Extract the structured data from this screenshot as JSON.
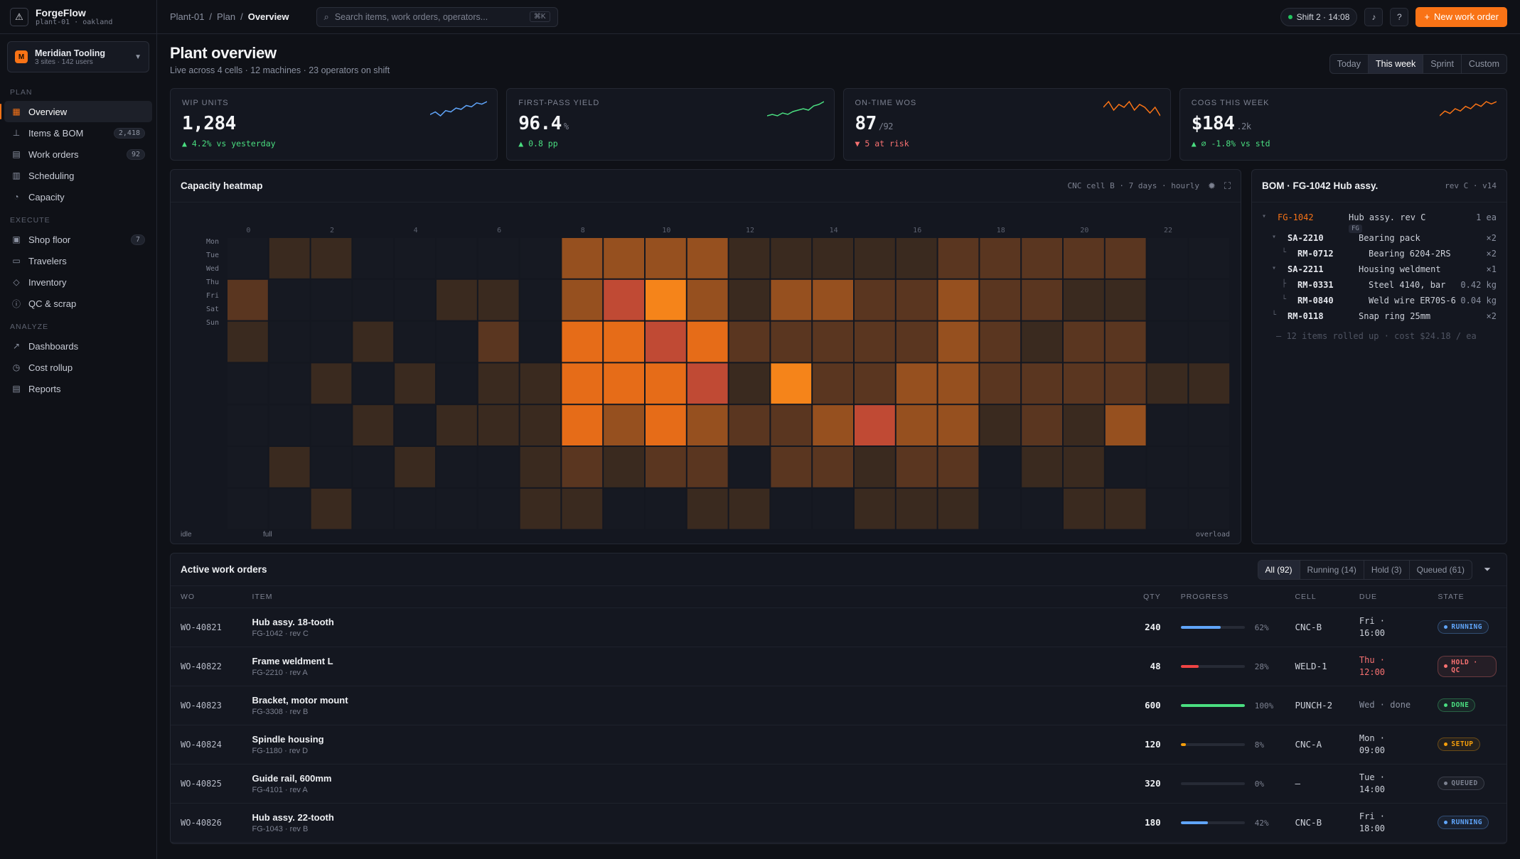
{
  "brand": {
    "name": "ForgeFlow",
    "sub": "plant-01 · oakland"
  },
  "org": {
    "initial": "M",
    "name": "Meridian Tooling",
    "sub": "3 sites · 142 users"
  },
  "nav": {
    "plan_label": "PLAN",
    "plan": [
      {
        "label": "Overview",
        "icon": "grid-icon",
        "badge": "",
        "active": true
      },
      {
        "label": "Items & BOM",
        "icon": "tree-icon",
        "badge": "2,418"
      },
      {
        "label": "Work orders",
        "icon": "doc-icon",
        "badge": "92"
      },
      {
        "label": "Scheduling",
        "icon": "bars-icon",
        "badge": ""
      },
      {
        "label": "Capacity",
        "icon": "gauge-icon",
        "badge": ""
      }
    ],
    "execute_label": "EXECUTE",
    "execute": [
      {
        "label": "Shop floor",
        "icon": "floor-icon",
        "badge": "7"
      },
      {
        "label": "Travelers",
        "icon": "folder-icon",
        "badge": ""
      },
      {
        "label": "Inventory",
        "icon": "box-icon",
        "badge": ""
      },
      {
        "label": "QC & scrap",
        "icon": "alert-icon",
        "badge": ""
      }
    ],
    "analyze_label": "ANALYZE",
    "analyze": [
      {
        "label": "Dashboards",
        "icon": "trend-icon",
        "badge": ""
      },
      {
        "label": "Cost rollup",
        "icon": "clock-icon",
        "badge": ""
      },
      {
        "label": "Reports",
        "icon": "report-icon",
        "badge": ""
      }
    ]
  },
  "breadcrumb": [
    "Plant-01",
    "Plan",
    "Overview"
  ],
  "search": {
    "placeholder": "Search items, work orders, operators...",
    "shortcut": "⌘K"
  },
  "shift": "Shift 2 · 14:08",
  "new_wo": "New work order",
  "page": {
    "title": "Plant overview",
    "sub": "Live across 4 cells · 12 machines · 23 operators on shift"
  },
  "ranges": [
    "Today",
    "This week",
    "Sprint",
    "Custom"
  ],
  "kpis": [
    {
      "label": "WIP UNITS",
      "value": "1,284",
      "unit": "",
      "delta": "▲ 4.2% vs yesterday",
      "delta_color": "#4ade80",
      "spark_color": "#60a5fa",
      "spark": [
        8,
        10,
        7,
        11,
        10,
        13,
        12,
        15,
        14,
        17,
        16,
        18
      ]
    },
    {
      "label": "FIRST-PASS YIELD",
      "value": "96.4",
      "unit": "%",
      "delta": "▲ 0.8 pp",
      "delta_color": "#4ade80",
      "spark_color": "#4ade80",
      "spark": [
        7,
        8,
        7,
        9,
        8,
        10,
        11,
        12,
        11,
        14,
        15,
        17
      ]
    },
    {
      "label": "ON-TIME WOS",
      "value": "87",
      "unit": "/92",
      "delta": "▼ 5 at risk",
      "delta_color": "#f87171",
      "spark_color": "#f97316",
      "spark": [
        14,
        16,
        13,
        15,
        14,
        16,
        13,
        15,
        14,
        12,
        14,
        11
      ]
    },
    {
      "label": "COGS THIS WEEK",
      "value": "$184",
      "unit": ".2k",
      "delta": "▲ ∅ -1.8% vs std",
      "delta_color": "#4ade80",
      "spark_color": "#f97316",
      "spark": [
        9,
        11,
        10,
        12,
        11,
        13,
        12,
        14,
        13,
        15,
        14,
        15
      ]
    }
  ],
  "heatmap": {
    "title": "Capacity heatmap",
    "meta": "CNC cell B · 7 days · hourly",
    "days": [
      "Mon",
      "Tue",
      "Wed",
      "Thu",
      "Fri",
      "Sat",
      "Sun"
    ],
    "hour_labels": [
      "0",
      "2",
      "4",
      "6",
      "8",
      "10",
      "12",
      "14",
      "16",
      "18",
      "20",
      "22"
    ],
    "legend": {
      "idle": "idle",
      "full": "full",
      "overload": "overload"
    },
    "colors": [
      "#161922",
      "#1c1f27",
      "#3a2a1f",
      "#5a3620",
      "#96501f",
      "#e66c18",
      "#f5841a",
      "#c04a34"
    ],
    "grid": [
      [
        0,
        2,
        2,
        0,
        0,
        0,
        0,
        0,
        4,
        4,
        4,
        4,
        2,
        2,
        2,
        2,
        2,
        3,
        3,
        3,
        3,
        3,
        0,
        0
      ],
      [
        3,
        0,
        0,
        0,
        0,
        2,
        2,
        0,
        4,
        7,
        6,
        4,
        2,
        4,
        4,
        3,
        3,
        4,
        3,
        3,
        2,
        2,
        0,
        0
      ],
      [
        2,
        0,
        0,
        2,
        0,
        0,
        3,
        0,
        5,
        5,
        7,
        5,
        3,
        3,
        3,
        3,
        3,
        4,
        3,
        2,
        3,
        3,
        0,
        0
      ],
      [
        0,
        0,
        2,
        0,
        2,
        0,
        2,
        2,
        5,
        5,
        5,
        7,
        2,
        6,
        3,
        3,
        4,
        4,
        3,
        3,
        3,
        3,
        2,
        2
      ],
      [
        0,
        0,
        0,
        2,
        0,
        2,
        2,
        2,
        5,
        4,
        5,
        4,
        3,
        3,
        4,
        7,
        4,
        4,
        2,
        3,
        2,
        4,
        0,
        0
      ],
      [
        0,
        2,
        0,
        0,
        2,
        0,
        0,
        2,
        3,
        2,
        3,
        3,
        0,
        3,
        3,
        2,
        3,
        3,
        0,
        2,
        2,
        0,
        0,
        0
      ],
      [
        0,
        0,
        2,
        0,
        0,
        0,
        0,
        2,
        2,
        0,
        0,
        2,
        2,
        0,
        0,
        2,
        2,
        2,
        0,
        0,
        2,
        2,
        0,
        0
      ]
    ]
  },
  "bom": {
    "title": "BOM · FG-1042 Hub assy.",
    "meta": "rev C · v14",
    "rows": [
      {
        "indent": 0,
        "caret": "▾",
        "code": "FG-1042",
        "name": "Hub assy. rev C",
        "tag": "FG",
        "qty": "1 ea",
        "accent": true
      },
      {
        "indent": 1,
        "caret": "▾",
        "code": "SA-2210",
        "name": "Bearing pack",
        "tag": "",
        "qty": "×2"
      },
      {
        "indent": 2,
        "caret": "└",
        "code": "RM-0712",
        "name": "Bearing 6204-2RS",
        "tag": "",
        "qty": "×2"
      },
      {
        "indent": 1,
        "caret": "▾",
        "code": "SA-2211",
        "name": "Housing weldment",
        "tag": "",
        "qty": "×1"
      },
      {
        "indent": 2,
        "caret": "├",
        "code": "RM-0331",
        "name": "Steel 4140, bar",
        "tag": "",
        "qty": "0.42 kg"
      },
      {
        "indent": 2,
        "caret": "└",
        "code": "RM-0840",
        "name": "Weld wire ER70S-6",
        "tag": "",
        "qty": "0.04 kg"
      },
      {
        "indent": 1,
        "caret": "└",
        "code": "RM-0118",
        "name": "Snap ring 25mm",
        "tag": "",
        "qty": "×2"
      }
    ],
    "footer": "— 12 items rolled up · cost $24.18 / ea"
  },
  "wo": {
    "title": "Active work orders",
    "filters": [
      "All (92)",
      "Running (14)",
      "Hold (3)",
      "Queued (61)"
    ],
    "columns": [
      "WO",
      "ITEM",
      "QTY",
      "PROGRESS",
      "CELL",
      "DUE",
      "STATE"
    ],
    "rows": [
      {
        "wo": "WO-40821",
        "item": "Hub assy. 18-tooth",
        "sub": "FG-1042 · rev C",
        "qty": "240",
        "pct": 62,
        "pct_label": "62%",
        "bar": "#60a5fa",
        "cell": "CNC-B",
        "due1": "Fri ·",
        "due2": "16:00",
        "due_color": "#cdd1da",
        "state": "RUNNING",
        "state_color": "#60a5fa"
      },
      {
        "wo": "WO-40822",
        "item": "Frame weldment L",
        "sub": "FG-2210 · rev A",
        "qty": "48",
        "pct": 28,
        "pct_label": "28%",
        "bar": "#ef4444",
        "cell": "WELD-1",
        "due1": "Thu ·",
        "due2": "12:00",
        "due_color": "#f87171",
        "state": "HOLD · QC",
        "state_color": "#f87171"
      },
      {
        "wo": "WO-40823",
        "item": "Bracket, motor mount",
        "sub": "FG-3308 · rev B",
        "qty": "600",
        "pct": 100,
        "pct_label": "100%",
        "bar": "#4ade80",
        "cell": "PUNCH-2",
        "due1": "Wed · done",
        "due2": "",
        "due_color": "#8a90a0",
        "state": "DONE",
        "state_color": "#4ade80"
      },
      {
        "wo": "WO-40824",
        "item": "Spindle housing",
        "sub": "FG-1180 · rev D",
        "qty": "120",
        "pct": 8,
        "pct_label": "8%",
        "bar": "#f59e0b",
        "cell": "CNC-A",
        "due1": "Mon ·",
        "due2": "09:00",
        "due_color": "#cdd1da",
        "state": "SETUP",
        "state_color": "#f59e0b"
      },
      {
        "wo": "WO-40825",
        "item": "Guide rail, 600mm",
        "sub": "FG-4101 · rev A",
        "qty": "320",
        "pct": 0,
        "pct_label": "0%",
        "bar": "#60a5fa",
        "cell": "—",
        "due1": "Tue ·",
        "due2": "14:00",
        "due_color": "#cdd1da",
        "state": "QUEUED",
        "state_color": "#7c8190"
      },
      {
        "wo": "WO-40826",
        "item": "Hub assy. 22-tooth",
        "sub": "FG-1043 · rev B",
        "qty": "180",
        "pct": 42,
        "pct_label": "42%",
        "bar": "#60a5fa",
        "cell": "CNC-B",
        "due1": "Fri ·",
        "due2": "18:00",
        "due_color": "#cdd1da",
        "state": "RUNNING",
        "state_color": "#60a5fa"
      }
    ]
  }
}
